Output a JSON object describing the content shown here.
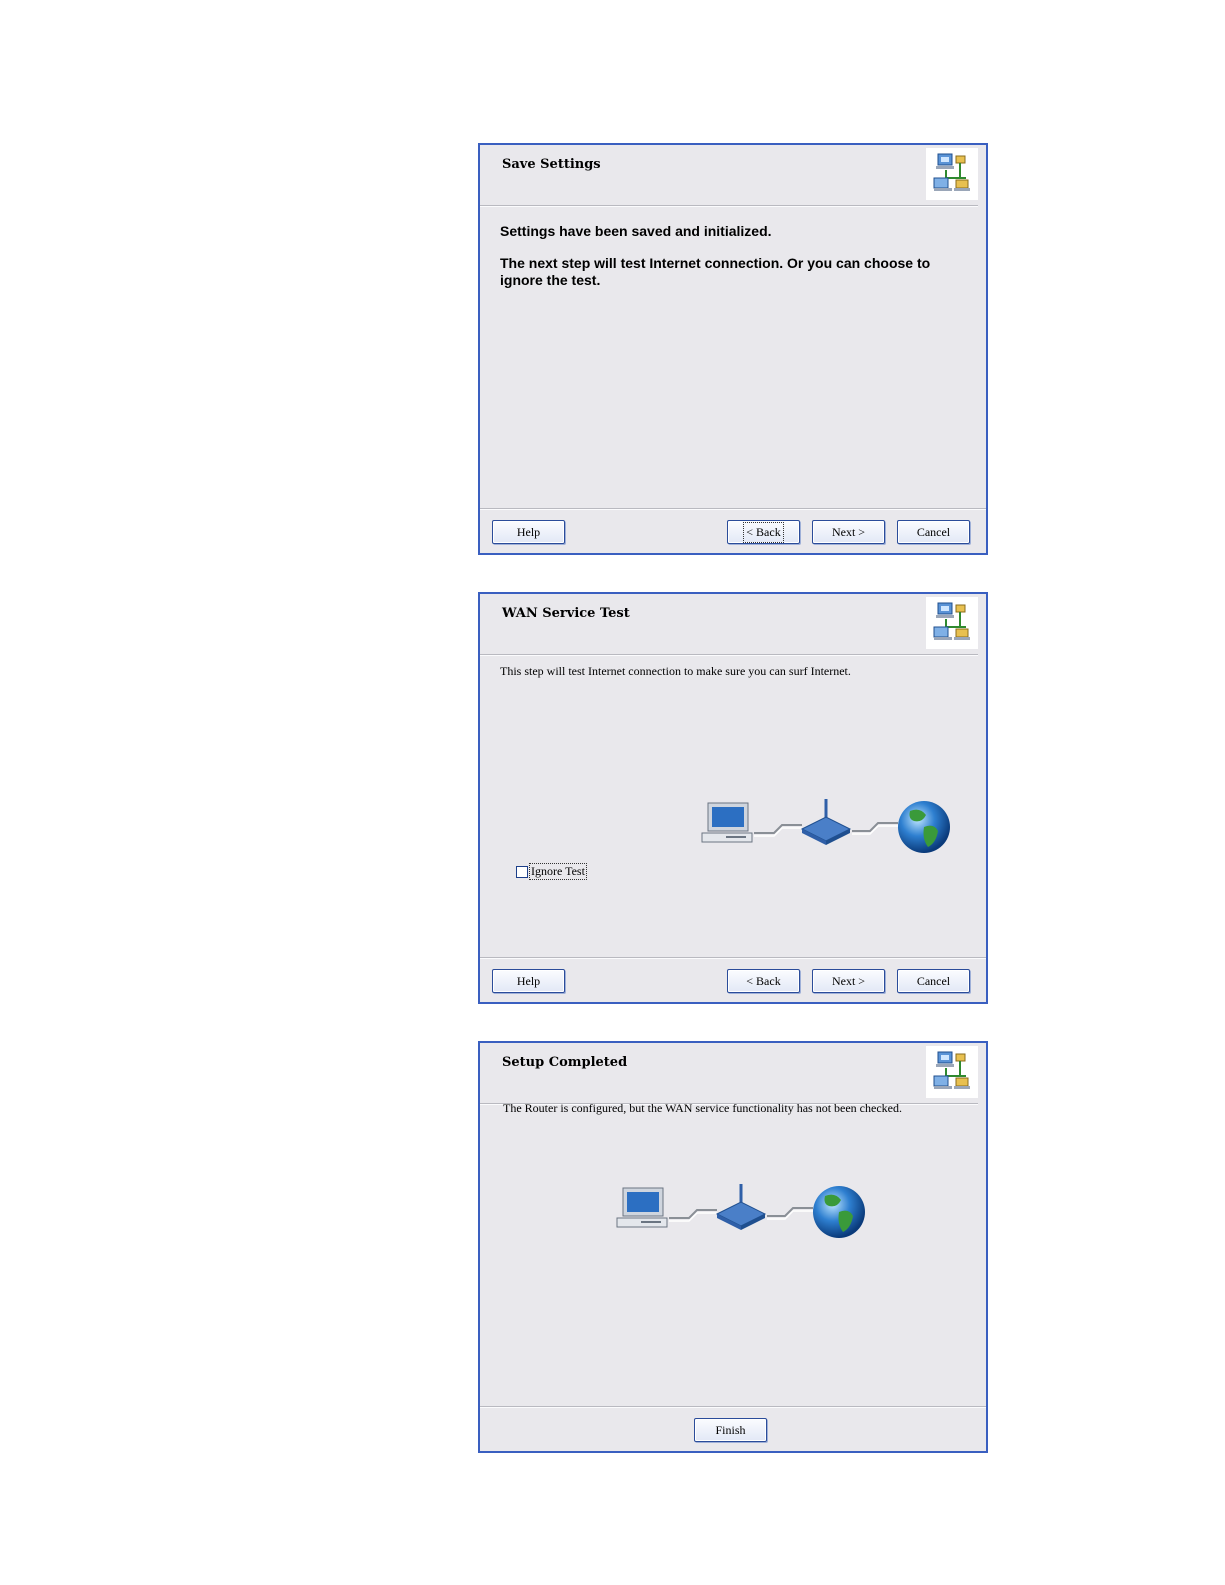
{
  "dialogs": [
    {
      "title": "Save Settings",
      "icon": "network-wizard-icon",
      "message_line1": "Settings have been saved and initialized.",
      "message_line2": "The next step will test Internet connection. Or you can choose to ignore the test.",
      "buttons": {
        "help": "Help",
        "back": "< Back",
        "next": "Next >",
        "cancel": "Cancel"
      }
    },
    {
      "title": "WAN Service Test",
      "icon": "network-wizard-icon",
      "description": "This step will test Internet connection to make sure you can surf Internet.",
      "diagram": "computer-router-globe",
      "checkbox": {
        "label": "Ignore Test",
        "checked": false
      },
      "buttons": {
        "help": "Help",
        "back": "< Back",
        "next": "Next >",
        "cancel": "Cancel"
      }
    },
    {
      "title": "Setup Completed",
      "icon": "network-wizard-icon",
      "description": "The Router is configured, but the WAN service functionality has not been checked.",
      "diagram": "computer-router-globe",
      "buttons": {
        "finish": "Finish"
      }
    }
  ],
  "colors": {
    "dialog_border": "#3a5fc0",
    "dialog_background": "#e9e8ec",
    "button_border": "#2b4c9a"
  }
}
